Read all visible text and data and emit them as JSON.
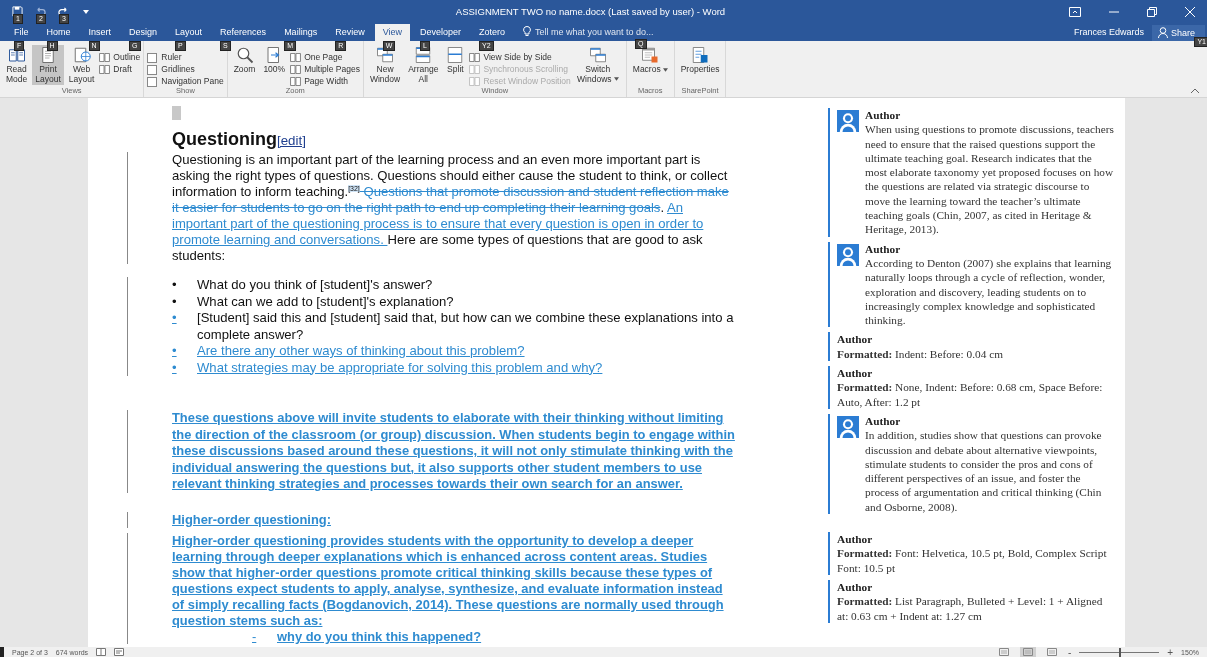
{
  "title_bar": {
    "quick_access": [
      {
        "keytip": "1"
      },
      {
        "keytip": "2"
      },
      {
        "keytip": "3"
      }
    ],
    "title": "ASSIGNMENT TWO no name.docx (Last saved by user) - Word",
    "user": "Frances Edwards",
    "share": {
      "label": "Share",
      "keytip": "Y1"
    }
  },
  "tabs": [
    {
      "label": "File",
      "keytip": "F",
      "selected": false
    },
    {
      "label": "Home",
      "keytip": "H",
      "selected": false
    },
    {
      "label": "Insert",
      "keytip": "N",
      "selected": false
    },
    {
      "label": "Design",
      "keytip": "G",
      "selected": false
    },
    {
      "label": "Layout",
      "keytip": "P",
      "selected": false
    },
    {
      "label": "References",
      "keytip": "S",
      "selected": false
    },
    {
      "label": "Mailings",
      "keytip": "M",
      "selected": false
    },
    {
      "label": "Review",
      "keytip": "R",
      "selected": false
    },
    {
      "label": "View",
      "keytip": "W",
      "selected": true
    },
    {
      "label": "Developer",
      "keytip": "L",
      "selected": false
    },
    {
      "label": "Zotero",
      "keytip": "Y2",
      "selected": false
    }
  ],
  "tell_me": {
    "placeholder": "Tell me what you want to do...",
    "keytip": "Q"
  },
  "ribbon_groups": [
    {
      "label": "Views",
      "columns": [
        {
          "kind": "large",
          "label": "Read Mode",
          "selected": false
        },
        {
          "kind": "large",
          "label": "Print Layout",
          "selected": true
        },
        {
          "kind": "large",
          "label": "Web Layout",
          "selected": false
        },
        {
          "kind": "stack",
          "items": [
            {
              "kind": "small",
              "label": "Outline",
              "disabled": false
            },
            {
              "kind": "small",
              "label": "Draft",
              "disabled": false
            }
          ]
        }
      ]
    },
    {
      "label": "Show",
      "columns": [
        {
          "kind": "stack",
          "items": [
            {
              "kind": "check",
              "label": "Ruler",
              "checked": false
            },
            {
              "kind": "check",
              "label": "Gridlines",
              "checked": false
            },
            {
              "kind": "check",
              "label": "Navigation Pane",
              "checked": false
            }
          ]
        }
      ]
    },
    {
      "label": "Zoom",
      "columns": [
        {
          "kind": "large",
          "label": "Zoom",
          "selected": false
        },
        {
          "kind": "large",
          "label": "100%",
          "selected": false
        },
        {
          "kind": "stack",
          "items": [
            {
              "kind": "small",
              "label": "One Page",
              "disabled": false
            },
            {
              "kind": "small",
              "label": "Multiple Pages",
              "disabled": false
            },
            {
              "kind": "small",
              "label": "Page Width",
              "disabled": false
            }
          ]
        }
      ]
    },
    {
      "label": "Window",
      "columns": [
        {
          "kind": "large",
          "label": "New Window",
          "selected": false
        },
        {
          "kind": "large",
          "label": "Arrange All",
          "selected": false
        },
        {
          "kind": "large",
          "label": "Split",
          "selected": false
        },
        {
          "kind": "stack",
          "items": [
            {
              "kind": "small",
              "label": "View Side by Side",
              "disabled": false
            },
            {
              "kind": "small",
              "label": "Synchronous Scrolling",
              "disabled": true
            },
            {
              "kind": "small",
              "label": "Reset Window Position",
              "disabled": true
            }
          ]
        },
        {
          "kind": "large",
          "label": "Switch Windows",
          "selected": false,
          "dropdown": true
        }
      ]
    },
    {
      "label": "Macros",
      "columns": [
        {
          "kind": "large",
          "label": "Macros",
          "selected": false,
          "dropdown": true
        }
      ]
    },
    {
      "label": "SharePoint",
      "columns": [
        {
          "kind": "large",
          "label": "Properties",
          "selected": false
        }
      ]
    }
  ],
  "document": {
    "heading": {
      "text": "Questioning",
      "link": "[edit]"
    },
    "blocks": [
      {
        "kind": "paragraph",
        "changed": true,
        "bold": false,
        "runs": [
          {
            "kind": "normal",
            "text": "Questioning is an important part of the learning process and an even more important part is asking the right types of questions. Questions should either cause the student to think, or collect information to inform teaching."
          },
          {
            "kind": "ref",
            "text": "[32]"
          },
          {
            "kind": "deleted",
            "text": " Questions that promote discussion and student reflection make it easier for students to go on the right path to end up completing their learning goals"
          },
          {
            "kind": "normal",
            "text": ". "
          },
          {
            "kind": "inserted",
            "text": "An important part of the questioning process is to ensure that every question is open in order to promote learning and conversations. "
          },
          {
            "kind": "normal",
            "text": "Here are some types of questions that are good to ask students:"
          }
        ]
      },
      {
        "kind": "bullets",
        "changed": true,
        "items": [
          {
            "bullet": "•",
            "bullet_changed": false,
            "runs": [
              {
                "kind": "normal",
                "text": "What do you think of [student]'s answer?"
              }
            ]
          },
          {
            "bullet": "•",
            "bullet_changed": false,
            "runs": [
              {
                "kind": "normal",
                "text": "What can we add to [student]'s explanation?"
              }
            ]
          },
          {
            "bullet": "•",
            "bullet_changed": true,
            "runs": [
              {
                "kind": "normal",
                "text": "[Student] said this and [student] said that, but how can we combine these explanations into a complete answer?"
              }
            ]
          },
          {
            "bullet": "•",
            "bullet_changed": true,
            "runs": [
              {
                "kind": "inserted",
                "text": "Are there any other ways of thinking about this problem?"
              }
            ]
          },
          {
            "bullet": "•",
            "bullet_changed": true,
            "runs": [
              {
                "kind": "inserted",
                "text": "What strategies may be appropriate for solving this problem and why?"
              }
            ]
          }
        ]
      },
      {
        "kind": "paragraph",
        "changed": true,
        "bold": true,
        "runs": [
          {
            "kind": "inserted",
            "text": "These questions above will invite students to elaborate with their thinking without limiting the direction of the classroom (or group) discussion. When students begin to engage within these discussions based around these questions, it will not only stimulate thinking with the individual answering the questions but, it also supports other student members to use relevant thinking strategies and processes towards their own search for an answer."
          }
        ]
      },
      {
        "kind": "paragraph",
        "changed": true,
        "bold": true,
        "runs": [
          {
            "kind": "inserted",
            "text": "Higher-order questioning:"
          }
        ]
      },
      {
        "kind": "paragraph",
        "changed": true,
        "bold": true,
        "runs": [
          {
            "kind": "inserted",
            "text": "Higher-order questioning provides students with the opportunity to develop a deeper learning through deeper explanations which is enhanced across content areas. Studies show that higher-order questions promote critical thinking skills because these types of questions expect students to apply, analyse, synthesize, and evaluate information instead of simply recalling facts (Bogdanovich, 2014). These questions are normally used through question stems such as:"
          }
        ]
      },
      {
        "kind": "sublist",
        "changed": true,
        "items": [
          {
            "bullet": "-",
            "bullet_changed": true,
            "runs": [
              {
                "kind": "inserted",
                "text": "why do you think this happened?"
              }
            ]
          }
        ]
      }
    ]
  },
  "comments": [
    {
      "kind": "comment",
      "author": "Author",
      "text": "When using questions to promote discussions, teachers need to ensure that the raised questions support the ultimate teaching goal. Research indicates that the most elaborate taxonomy yet proposed focuses on how the questions are related via strategic discourse to move the learning toward the teacher’s ultimate teaching goals (Chin, 2007, as cited in Heritage & Heritage, 2013)."
    },
    {
      "kind": "comment",
      "author": "Author",
      "text": "According to Denton (2007) she explains that learning naturally loops through a cycle of reflection, wonder, exploration and discovery, leading students on to increasingly complex knowledge and sophisticated thinking."
    },
    {
      "kind": "formatting",
      "author": "Author",
      "text": "**Formatted:** Indent: Before:  0.04 cm"
    },
    {
      "kind": "formatting",
      "author": "Author",
      "text": "**Formatted:** None, Indent: Before:  0.68 cm, Space Before: Auto, After:  1.2 pt"
    },
    {
      "kind": "comment",
      "author": "Author",
      "text": "In addition, studies show that questions can provoke discussion and debate about alternative viewpoints, stimulate students to consider the pros and cons of different perspectives of an issue, and foster the process of argumentation and critical thinking (Chin and Osborne, 2008)."
    },
    {
      "kind": "formatting",
      "author": "Author",
      "text": "**Formatted:** Font: Helvetica, 10.5 pt, Bold, Complex Script Font: 10.5 pt"
    },
    {
      "kind": "formatting",
      "author": "Author",
      "text": "**Formatted:** List Paragraph, Bulleted + Level: 1 + Aligned at:  0.63 cm + Indent at:  1.27 cm"
    }
  ],
  "status_bar": {
    "page": "Page 2 of 3",
    "words": "674 words",
    "view_buttons": [
      {
        "selected": false
      },
      {
        "selected": true
      },
      {
        "selected": false
      }
    ],
    "zoom": {
      "minus": "-",
      "plus": "+",
      "level": 0.5,
      "reading": "150%"
    }
  }
}
